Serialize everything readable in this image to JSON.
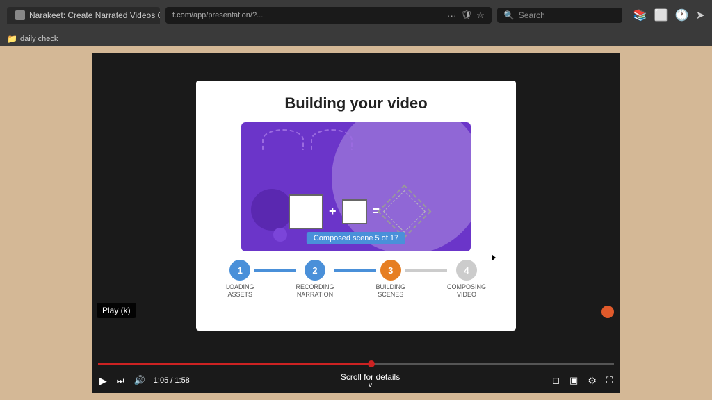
{
  "browser": {
    "tab_title": "Narakeet: Create Narrated Videos Quickly!",
    "url": "t.com/app/presentation/?...",
    "url_dots": "···",
    "search_placeholder": "Search",
    "bookmark_label": "daily check"
  },
  "video": {
    "slide_title": "Building your video",
    "progress_label": "Composed scene 5 of 17",
    "steps": [
      {
        "number": "1",
        "label": "LOADING\nASSETS",
        "state": "done"
      },
      {
        "number": "2",
        "label": "RECORDING\nNARRATION",
        "state": "done"
      },
      {
        "number": "3",
        "label": "BUILDING\nSCENES",
        "state": "current"
      },
      {
        "number": "4",
        "label": "COMPOSING\nVIDEO",
        "state": "pending"
      }
    ],
    "time_current": "1:05",
    "time_total": "1:58",
    "scroll_text": "Scroll for details",
    "play_tooltip": "Play (k)",
    "controls": {
      "play": "▶",
      "skip": "⏭",
      "volume": "🔊",
      "fullscreen": "⛶",
      "settings": "⚙",
      "captions": "▣",
      "theater": "▣",
      "miniplayer": "◻"
    }
  },
  "progress_pct": 53
}
